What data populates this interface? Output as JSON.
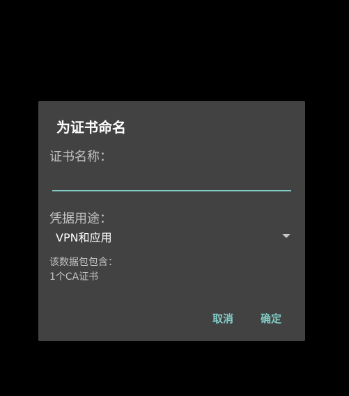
{
  "dialog": {
    "title": "为证书命名",
    "name_label": "证书名称：",
    "name_value": "",
    "usage_label": "凭据用途：",
    "usage_selected": "VPN和应用",
    "contains_label": "该数据包包含：",
    "contains_value": "1个CA证书",
    "cancel_label": "取消",
    "ok_label": "确定"
  },
  "colors": {
    "accent": "#80cbc4",
    "dialog_bg": "#424242",
    "backdrop": "#000000"
  }
}
